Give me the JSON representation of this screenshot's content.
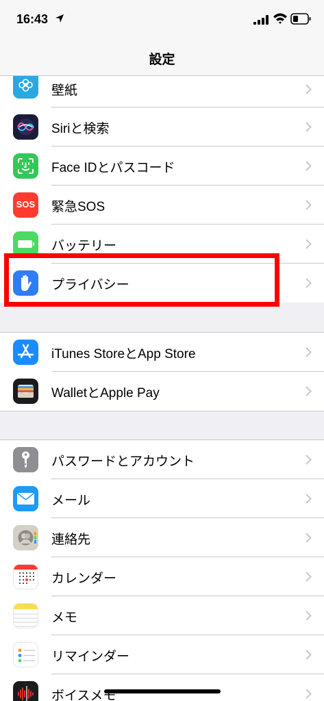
{
  "status_bar": {
    "time": "16:43"
  },
  "nav": {
    "title": "設定"
  },
  "group1": [
    {
      "label": "壁紙",
      "icon": "wallpaper-icon"
    },
    {
      "label": "Siriと検索",
      "icon": "siri-icon"
    },
    {
      "label": "Face IDとパスコード",
      "icon": "faceid-icon"
    },
    {
      "label": "緊急SOS",
      "icon": "sos-icon",
      "icon_text": "SOS"
    },
    {
      "label": "バッテリー",
      "icon": "battery-icon"
    },
    {
      "label": "プライバシー",
      "icon": "privacy-hand-icon"
    }
  ],
  "group2": [
    {
      "label": "iTunes StoreとApp Store",
      "icon": "app-store-icon"
    },
    {
      "label": "WalletとApple Pay",
      "icon": "wallet-icon"
    }
  ],
  "group3": [
    {
      "label": "パスワードとアカウント",
      "icon": "key-icon"
    },
    {
      "label": "メール",
      "icon": "mail-icon"
    },
    {
      "label": "連絡先",
      "icon": "contacts-icon"
    },
    {
      "label": "カレンダー",
      "icon": "calendar-icon"
    },
    {
      "label": "メモ",
      "icon": "notes-icon"
    },
    {
      "label": "リマインダー",
      "icon": "reminders-icon"
    },
    {
      "label": "ボイスメモ",
      "icon": "voice-memos-icon"
    }
  ],
  "colors": {
    "highlight": "#ff0000",
    "siri": "#1c1c3a",
    "faceid": "#34c759",
    "sos": "#ff3b30",
    "battery": "#4cd964",
    "privacy": "#2f7cf6",
    "appstore": "#1a8cff",
    "wallet": "#1c1c1e",
    "key": "#8e8e93",
    "mail": "#1e9bf5",
    "contacts": "#c8c4bc",
    "notes": "#fddb4f"
  }
}
